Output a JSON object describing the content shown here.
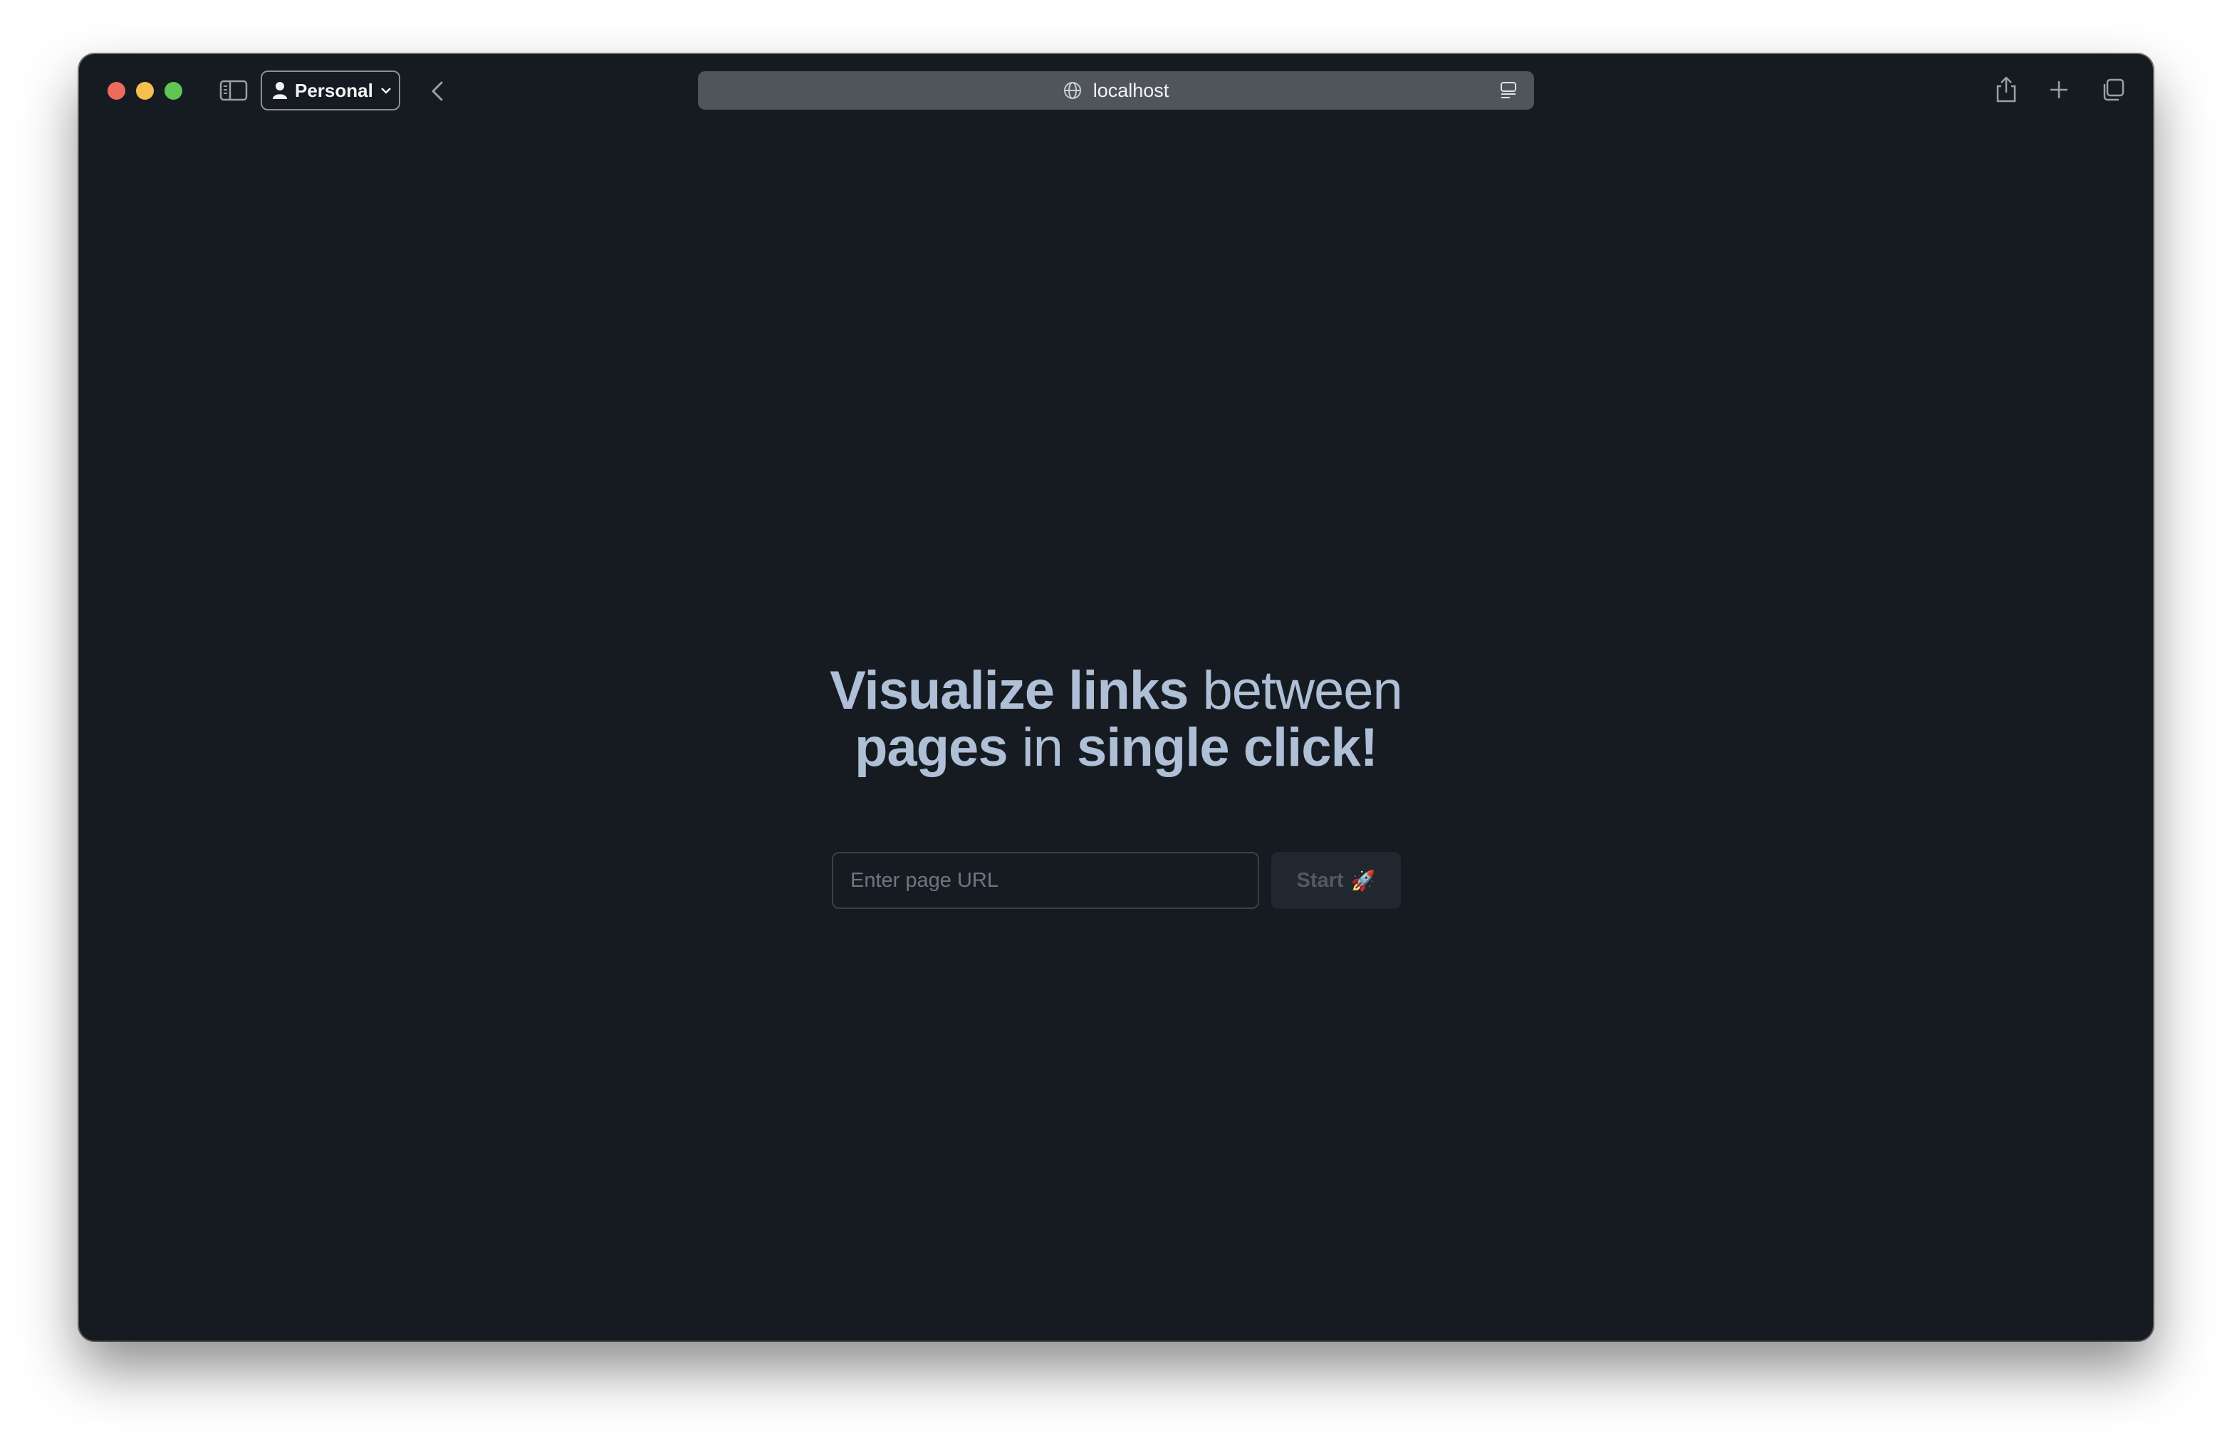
{
  "browser": {
    "profile_label": "Personal",
    "address": "localhost",
    "icons": {
      "sidebar": "sidebar-icon",
      "person": "person-icon",
      "chevron": "chevron-down-icon",
      "back": "back-arrow-icon",
      "globe": "globe-icon",
      "reader": "reader-icon",
      "share": "share-icon",
      "new_tab": "plus-icon",
      "tabs": "tab-overview-icon"
    },
    "traffic_colors": {
      "close": "#ed6a5e",
      "minimize": "#f4bf4f",
      "maximize": "#61c554"
    }
  },
  "page": {
    "headline": {
      "part1_bold": "Visualize links",
      "part2": " between",
      "part3_bold": "pages",
      "part4": " in ",
      "part5_bold": "single click!"
    },
    "url_input": {
      "placeholder": "Enter page URL",
      "value": ""
    },
    "start_button": {
      "label": "Start",
      "emoji": "🚀"
    },
    "colors": {
      "background": "#161b22",
      "headline": "#aebfd6"
    }
  }
}
